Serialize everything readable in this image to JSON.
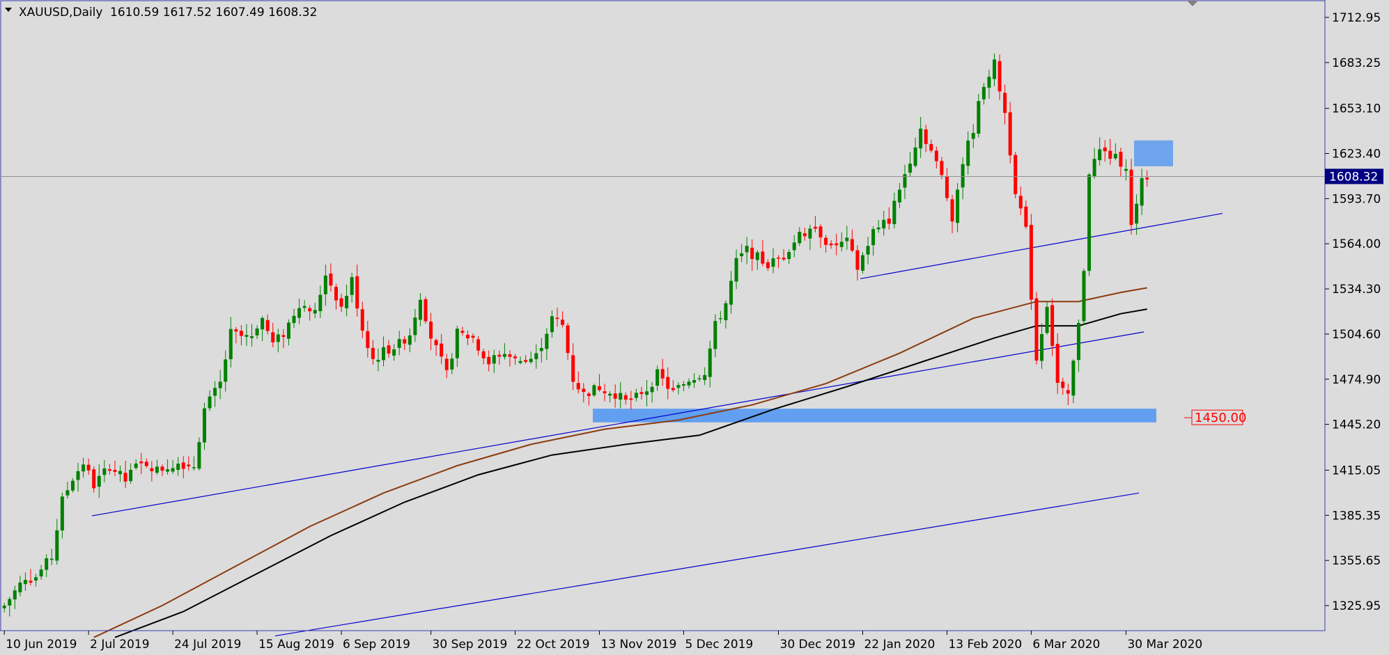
{
  "header": {
    "symbol_timeframe": "XAUUSD,Daily",
    "ohlc": "1610.59 1617.52 1607.49 1608.32"
  },
  "colors": {
    "background": "#dcdcdc",
    "axis": "#3c3cb4",
    "bull": "#008000",
    "bear": "#ff0000",
    "trendline": "#0000cd",
    "zone": "#5b9bf0",
    "ma_fast": "#8b3a0f",
    "ma_slow": "#000000",
    "price_tag": "#000080",
    "alert": "#ff0000"
  },
  "icons": {
    "menu": "triangle-down-icon",
    "shift_marker": "triangle-down-icon"
  },
  "chart_data": {
    "type": "candlestick",
    "y_ticks": [
      1712.95,
      1683.25,
      1653.1,
      1623.4,
      1593.7,
      1564.0,
      1534.3,
      1504.6,
      1474.9,
      1445.2,
      1415.05,
      1385.35,
      1355.65,
      1325.95
    ],
    "ylim": [
      1305,
      1722
    ],
    "x_ticks": [
      "10 Jun 2019",
      "2 Jul 2019",
      "24 Jul 2019",
      "15 Aug 2019",
      "6 Sep 2019",
      "30 Sep 2019",
      "22 Oct 2019",
      "13 Nov 2019",
      "5 Dec 2019",
      "30 Dec 2019",
      "22 Jan 2020",
      "13 Feb 2020",
      "6 Mar 2020",
      "30 Mar 2020"
    ],
    "grid": false,
    "current_price": "1608.32",
    "alert_level": "1450.00",
    "close_path": [
      [
        0,
        1326
      ],
      [
        3,
        1340
      ],
      [
        6,
        1345
      ],
      [
        9,
        1358
      ],
      [
        11,
        1395
      ],
      [
        13,
        1410
      ],
      [
        15,
        1420
      ],
      [
        17,
        1405
      ],
      [
        20,
        1418
      ],
      [
        23,
        1408
      ],
      [
        26,
        1422
      ],
      [
        29,
        1415
      ],
      [
        33,
        1420
      ],
      [
        36,
        1418
      ],
      [
        38,
        1455
      ],
      [
        41,
        1472
      ],
      [
        43,
        1505
      ],
      [
        46,
        1502
      ],
      [
        49,
        1515
      ],
      [
        51,
        1498
      ],
      [
        53,
        1505
      ],
      [
        56,
        1525
      ],
      [
        59,
        1518
      ],
      [
        61,
        1545
      ],
      [
        64,
        1522
      ],
      [
        66,
        1540
      ],
      [
        68,
        1508
      ],
      [
        70,
        1488
      ],
      [
        72,
        1493
      ],
      [
        75,
        1498
      ],
      [
        77,
        1505
      ],
      [
        79,
        1530
      ],
      [
        81,
        1503
      ],
      [
        84,
        1478
      ],
      [
        86,
        1505
      ],
      [
        89,
        1502
      ],
      [
        92,
        1486
      ],
      [
        95,
        1492
      ],
      [
        98,
        1485
      ],
      [
        101,
        1490
      ],
      [
        104,
        1515
      ],
      [
        106,
        1510
      ],
      [
        108,
        1475
      ],
      [
        110,
        1465
      ],
      [
        113,
        1470
      ],
      [
        115,
        1468
      ],
      [
        118,
        1460
      ],
      [
        121,
        1464
      ],
      [
        124,
        1478
      ],
      [
        127,
        1466
      ],
      [
        130,
        1475
      ],
      [
        133,
        1480
      ],
      [
        135,
        1510
      ],
      [
        137,
        1525
      ],
      [
        139,
        1552
      ],
      [
        141,
        1560
      ],
      [
        143,
        1555
      ],
      [
        145,
        1550
      ],
      [
        148,
        1556
      ],
      [
        151,
        1570
      ],
      [
        154,
        1575
      ],
      [
        157,
        1562
      ],
      [
        160,
        1565
      ],
      [
        162,
        1548
      ],
      [
        165,
        1572
      ],
      [
        168,
        1580
      ],
      [
        170,
        1600
      ],
      [
        172,
        1620
      ],
      [
        174,
        1640
      ],
      [
        176,
        1625
      ],
      [
        178,
        1608
      ],
      [
        180,
        1582
      ],
      [
        182,
        1618
      ],
      [
        184,
        1640
      ],
      [
        186,
        1670
      ],
      [
        188,
        1682
      ],
      [
        190,
        1650
      ],
      [
        192,
        1600
      ],
      [
        194,
        1572
      ],
      [
        196,
        1488
      ],
      [
        198,
        1525
      ],
      [
        200,
        1472
      ],
      [
        202,
        1462
      ],
      [
        204,
        1510
      ],
      [
        205,
        1548
      ],
      [
        206,
        1612
      ],
      [
        208,
        1625
      ],
      [
        211,
        1620
      ],
      [
        213,
        1616
      ],
      [
        214,
        1575
      ],
      [
        215,
        1592
      ],
      [
        216,
        1604
      ],
      [
        217,
        1608.32
      ]
    ],
    "ma_fast": [
      [
        17,
        1305
      ],
      [
        30,
        1326
      ],
      [
        44,
        1352
      ],
      [
        58,
        1378
      ],
      [
        72,
        1400
      ],
      [
        86,
        1418
      ],
      [
        100,
        1432
      ],
      [
        114,
        1442
      ],
      [
        128,
        1448
      ],
      [
        142,
        1458
      ],
      [
        156,
        1472
      ],
      [
        170,
        1492
      ],
      [
        184,
        1515
      ],
      [
        196,
        1526
      ],
      [
        204,
        1526
      ],
      [
        212,
        1532
      ],
      [
        217,
        1535
      ]
    ],
    "ma_slow": [
      [
        21,
        1305
      ],
      [
        34,
        1322
      ],
      [
        48,
        1347
      ],
      [
        62,
        1372
      ],
      [
        76,
        1394
      ],
      [
        90,
        1412
      ],
      [
        104,
        1425
      ],
      [
        118,
        1432
      ],
      [
        132,
        1438
      ],
      [
        146,
        1455
      ],
      [
        160,
        1470
      ],
      [
        174,
        1486
      ],
      [
        188,
        1502
      ],
      [
        196,
        1510
      ],
      [
        204,
        1510
      ],
      [
        212,
        1518
      ],
      [
        217,
        1521
      ]
    ]
  }
}
